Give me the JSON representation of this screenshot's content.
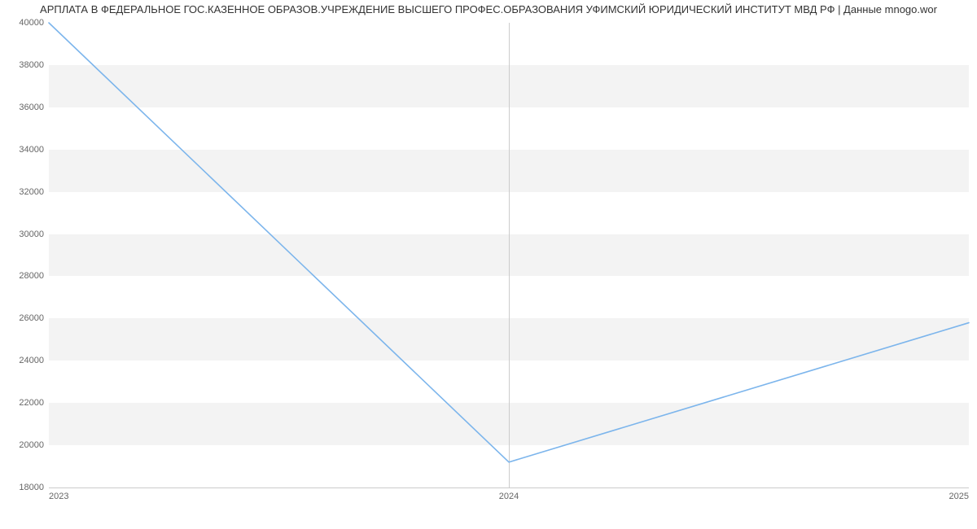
{
  "chart_data": {
    "type": "line",
    "title": "АРПЛАТА В ФЕДЕРАЛЬНОЕ ГОС.КАЗЕННОЕ ОБРАЗОВ.УЧРЕЖДЕНИЕ ВЫСШЕГО ПРОФЕС.ОБРАЗОВАНИЯ УФИМСКИЙ ЮРИДИЧЕСКИЙ ИНСТИТУТ МВД РФ | Данные mnogo.wor",
    "x": [
      2023,
      2024,
      2025
    ],
    "values": [
      40000,
      19200,
      25800
    ],
    "x_ticks": [
      "2023",
      "2024",
      "2025"
    ],
    "y_ticks": [
      18000,
      20000,
      22000,
      24000,
      26000,
      28000,
      30000,
      32000,
      34000,
      36000,
      38000,
      40000
    ],
    "xlim": [
      2023,
      2025
    ],
    "ylim": [
      18000,
      40000
    ],
    "line_color": "#7cb5ec",
    "band_color": "#f3f3f3"
  }
}
